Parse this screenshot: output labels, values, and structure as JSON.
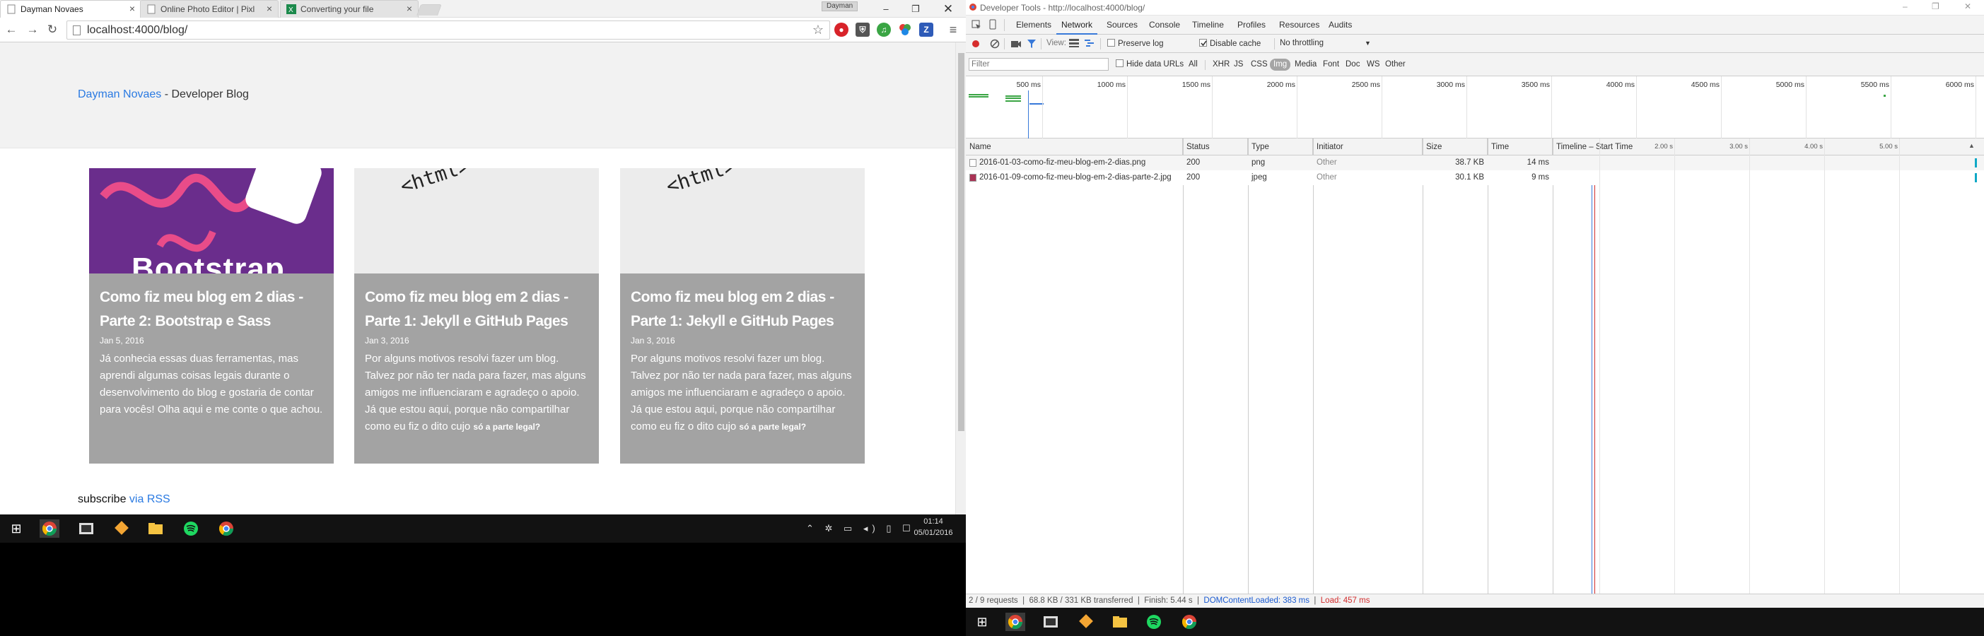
{
  "browser": {
    "tabs": [
      {
        "label": "Dayman Novaes"
      },
      {
        "label": "Online Photo Editor | Pixl"
      },
      {
        "label": "Converting your file"
      }
    ],
    "profile_badge": "Dayman",
    "url": "localhost:4000/blog/"
  },
  "blog": {
    "site_name": "Dayman Novaes",
    "site_suffix": " - Developer Blog",
    "posts": [
      {
        "title": "Como fiz meu blog em 2 dias - Parte 2: Bootstrap e Sass",
        "date": "Jan 5, 2016",
        "excerpt": "Já conhecia essas duas ferramentas, mas aprendi algumas coisas legais durante o desenvolvimento do blog e gostaria de contar para vocês! Olha aqui e me conte o que achou.",
        "excerpt_small": "",
        "thumb_text": "Bootstrap"
      },
      {
        "title": "Como fiz meu blog em 2 dias - Parte 1: Jekyll e GitHub Pages",
        "date": "Jan 3, 2016",
        "excerpt": "Por alguns motivos resolvi fazer um blog. Talvez por não ter nada para fazer, mas alguns amigos me influenciaram e agradeço o apoio. Já que estou aqui, porque não compartilhar como eu fiz o dito cujo ",
        "excerpt_small": "só a parte legal?",
        "thumb_text": "<html> <head> <title>"
      },
      {
        "title": "Como fiz meu blog em 2 dias - Parte 1: Jekyll e GitHub Pages",
        "date": "Jan 3, 2016",
        "excerpt": "Por alguns motivos resolvi fazer um blog. Talvez por não ter nada para fazer, mas alguns amigos me influenciaram e agradeço o apoio. Já que estou aqui, porque não compartilhar como eu fiz o dito cujo ",
        "excerpt_small": "só a parte legal?",
        "thumb_text": "<html> <head> <title>"
      }
    ],
    "subscribe_label": "subscribe ",
    "subscribe_link": "via RSS"
  },
  "taskbar_left": {
    "time": "01:14",
    "date": "05/01/2016"
  },
  "devtools": {
    "title": "Developer Tools - http://localhost:4000/blog/",
    "tabs": [
      "Elements",
      "Network",
      "Sources",
      "Console",
      "Timeline",
      "Profiles",
      "Resources",
      "Audits"
    ],
    "active_tab": "Network",
    "view_label": "View:",
    "preserve_log": "Preserve log",
    "disable_cache": "Disable cache",
    "throttling": "No throttling",
    "filter_placeholder": "Filter",
    "hide_data_urls": "Hide data URLs",
    "filter_types": [
      "All",
      "XHR",
      "JS",
      "CSS",
      "Img",
      "Media",
      "Font",
      "Doc",
      "WS",
      "Other"
    ],
    "active_filter": "Img",
    "overview_ticks": [
      "500 ms",
      "1000 ms",
      "1500 ms",
      "2000 ms",
      "2500 ms",
      "3000 ms",
      "3500 ms",
      "4000 ms",
      "4500 ms",
      "5000 ms",
      "5500 ms",
      "6000 ms"
    ],
    "columns": [
      "Name",
      "Status",
      "Type",
      "Initiator",
      "Size",
      "Time",
      "Timeline – Start Time"
    ],
    "timeline_ticks": [
      "2.00 s",
      "3.00 s",
      "4.00 s",
      "5.00 s"
    ],
    "requests": [
      {
        "name": "2016-01-03-como-fiz-meu-blog-em-2-dias.png",
        "status": "200",
        "type": "png",
        "initiator": "Other",
        "size": "38.7 KB",
        "time": "14 ms"
      },
      {
        "name": "2016-01-09-como-fiz-meu-blog-em-2-dias-parte-2.jpg",
        "status": "200",
        "type": "jpeg",
        "initiator": "Other",
        "size": "30.1 KB",
        "time": "9 ms"
      }
    ],
    "status_bar": {
      "summary": "2 / 9 requests  |  68.8 KB / 331 KB transferred  |  Finish: 5.44 s  |  ",
      "dom": "DOMContentLoaded: 383 ms",
      "sep": "  |  ",
      "load": "Load: 457 ms"
    }
  },
  "colors": {
    "link": "#2a7ae2",
    "card_bg": "#a3a3a3",
    "taskbar": "#121212",
    "devtools_accent": "#3879d9"
  }
}
